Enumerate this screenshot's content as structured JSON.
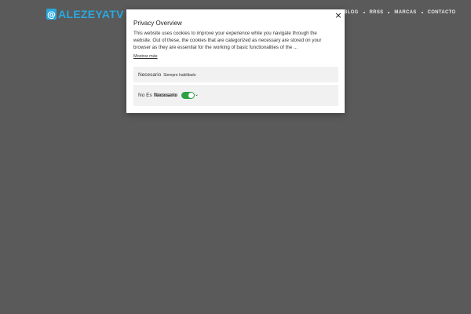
{
  "header": {
    "logo_symbol": "@",
    "logo_main": "ALEZEYA",
    "logo_accent": "TV",
    "nav": [
      "BLOG",
      "RRSS",
      "MARCAS",
      "CONTACTO"
    ]
  },
  "modal": {
    "title": "Privacy Overview",
    "close_symbol": "×",
    "description": "This website uses cookies to improve your experience while you navigate through the website. Out of these, the cookies that are categorized as necessary are stored on your browser as they are essential for the working of basic functionalities of the ...",
    "show_more": "Mostrar más",
    "categories": [
      {
        "label": "Necesario",
        "status": "Siempre habilitado"
      },
      {
        "label": "No Es Necesario",
        "overlap_label": "Necesario",
        "enabled": true
      }
    ]
  },
  "colors": {
    "brand": "#29a8e0",
    "toggle_on": "#2ea043",
    "background": "#5a5a5a"
  }
}
